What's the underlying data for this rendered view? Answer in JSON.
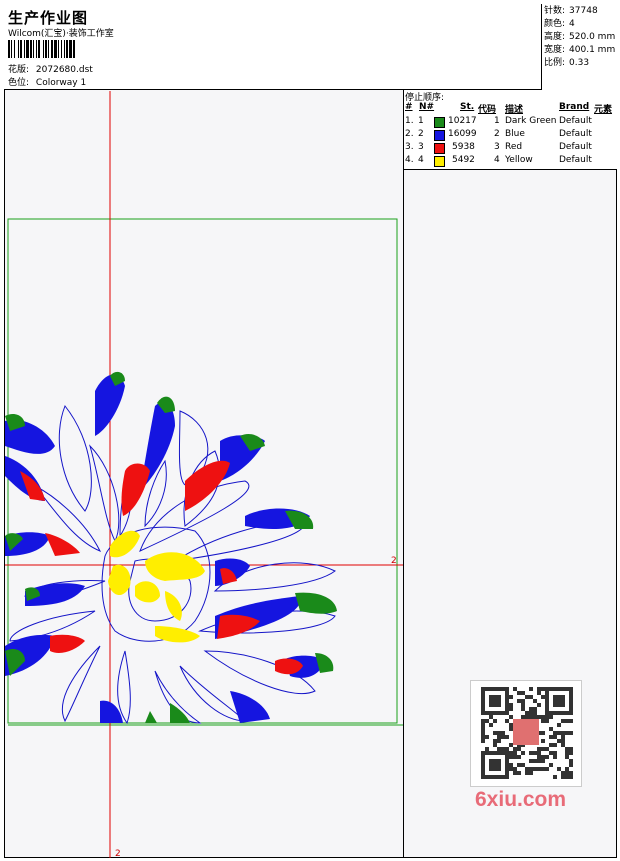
{
  "header": {
    "title": "生产作业图",
    "studio": "Wilcom(汇宝)·装饰工作室",
    "design_label": "花版:",
    "design_value": "2072680.dst",
    "colorway_label": "色位:",
    "colorway_value": "Colorway 1"
  },
  "stats": {
    "stitches_label": "针数:",
    "stitches_value": "37748",
    "colors_label": "颜色:",
    "colors_value": "4",
    "height_label": "高度:",
    "height_value": "520.0 mm",
    "width_label": "宽度:",
    "width_value": "400.1 mm",
    "scale_label": "比例:",
    "scale_value": "0.33"
  },
  "stop_sequence": {
    "caption": "停止顺序:",
    "columns": [
      "#",
      "N#",
      "St.",
      "代码",
      "描述",
      "Brand",
      "元素"
    ],
    "rows": [
      {
        "num": "1.",
        "n": "1",
        "color": "#1a8a1a",
        "st": "10217",
        "code": "1",
        "desc": "Dark Green",
        "brand": "Default"
      },
      {
        "num": "2.",
        "n": "2",
        "color": "#1515e0",
        "st": "16099",
        "code": "2",
        "desc": "Blue",
        "brand": "Default"
      },
      {
        "num": "3.",
        "n": "3",
        "color": "#ee1111",
        "st": "5938",
        "code": "3",
        "desc": "Red",
        "brand": "Default"
      },
      {
        "num": "4.",
        "n": "4",
        "color": "#ffee00",
        "st": "5492",
        "code": "4",
        "desc": "Yellow",
        "brand": "Default"
      }
    ]
  },
  "canvas": {
    "crosshair_mark_right": "2",
    "crosshair_mark_bottom": "2"
  },
  "watermark": {
    "text": "6xiu.com"
  }
}
